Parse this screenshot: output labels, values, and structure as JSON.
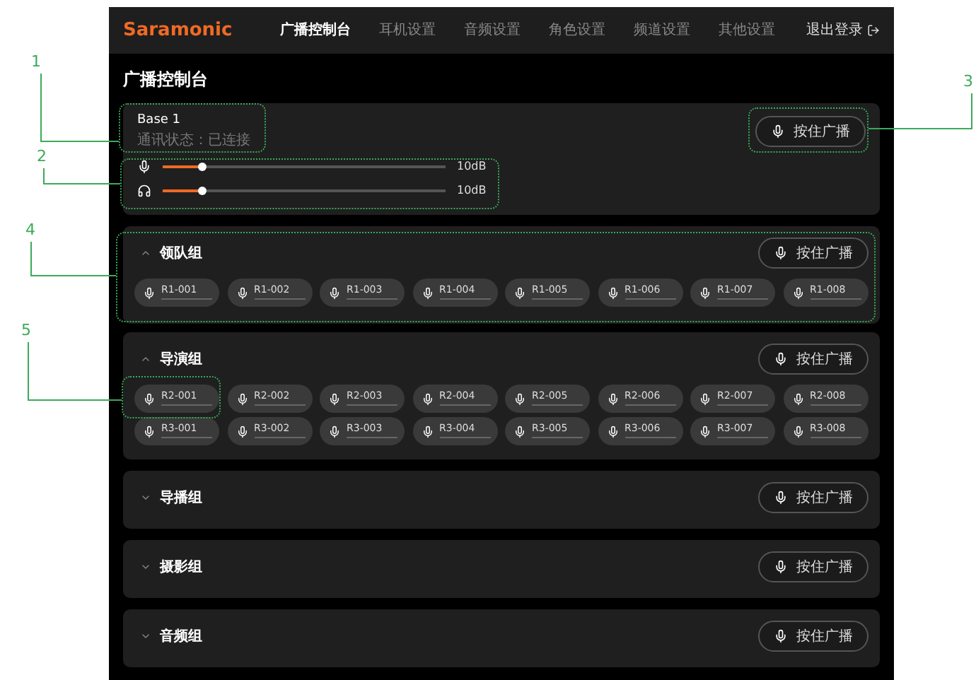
{
  "nav": {
    "logo": "Saramonic",
    "tabs": [
      {
        "label": "广播控制台",
        "selected": true
      },
      {
        "label": "耳机设置",
        "selected": false
      },
      {
        "label": "音频设置",
        "selected": false
      },
      {
        "label": "角色设置",
        "selected": false
      },
      {
        "label": "频道设置",
        "selected": false
      },
      {
        "label": "其他设置",
        "selected": false
      }
    ],
    "logout": "退出登录"
  },
  "page_title": "广播控制台",
  "base": {
    "name": "Base 1",
    "status": "通讯状态：已连接",
    "button": "按住广播",
    "sliders": [
      {
        "kind": "mic",
        "level": 0.14,
        "reading": "10dB"
      },
      {
        "kind": "headphone",
        "level": 0.14,
        "reading": "10dB"
      }
    ]
  },
  "groups": [
    {
      "name": "领队组",
      "expanded": true,
      "button": "按住广播",
      "devices": [
        "R1-001",
        "R1-002",
        "R1-003",
        "R1-004",
        "R1-005",
        "R1-006",
        "R1-007",
        "R1-008"
      ]
    },
    {
      "name": "导演组",
      "expanded": true,
      "button": "按住广播",
      "devices": [
        "R2-001",
        "R2-002",
        "R2-003",
        "R2-004",
        "R2-005",
        "R2-006",
        "R2-007",
        "R2-008",
        "R3-001",
        "R3-002",
        "R3-003",
        "R3-004",
        "R3-005",
        "R3-006",
        "R3-007",
        "R3-008"
      ]
    },
    {
      "name": "导播组",
      "expanded": false,
      "button": "按住广播"
    },
    {
      "name": "摄影组",
      "expanded": false,
      "button": "按住广播"
    },
    {
      "name": "音频组",
      "expanded": false,
      "button": "按住广播"
    }
  ],
  "callouts": [
    "1",
    "2",
    "3",
    "4",
    "5"
  ]
}
